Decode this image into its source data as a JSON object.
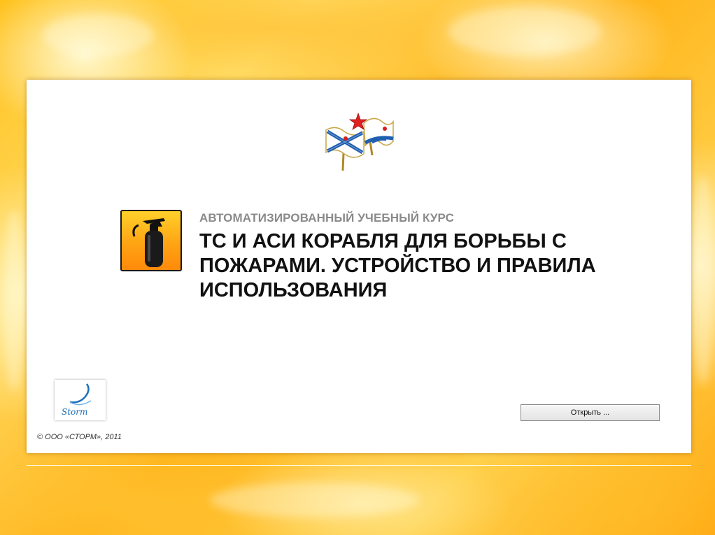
{
  "course": {
    "subtitle": "АВТОМАТИЗИРОВАННЫЙ УЧЕБНЫЙ КУРС",
    "title": "ТС И АСИ КОРАБЛЯ ДЛЯ БОРЬБЫ С ПОЖАРАМИ. УСТРОЙСТВО И ПРАВИЛА ИСПОЛЬЗОВАНИЯ"
  },
  "actions": {
    "open_label": "Открыть ..."
  },
  "footer": {
    "copyright": "© ООО «СТОРМ», 2011"
  },
  "logo": {
    "storm_text": "Storm"
  },
  "icons": {
    "flag": "naval-flag-icon",
    "extinguisher": "fire-extinguisher-icon"
  },
  "colors": {
    "background_fire": "#ffc21e",
    "icon_orange": "#ffa414",
    "subtitle_gray": "#8a8a8a",
    "logo_blue": "#1c6fb8"
  }
}
